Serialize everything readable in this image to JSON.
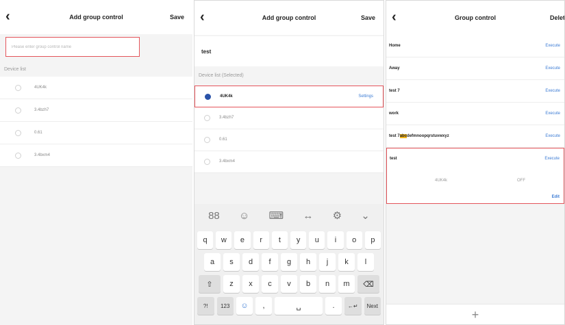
{
  "panel1": {
    "title": "Add group control",
    "save": "Save",
    "name_placeholder": "Please enter group control name",
    "list_label": "Device list",
    "devices": [
      "4UK4k",
      "3.4bzh7",
      "0.61",
      "3.4bxm4"
    ]
  },
  "panel2": {
    "title": "Add group control",
    "save": "Save",
    "name_value": "test",
    "list_label": "Device list (Selected)",
    "devices": [
      "4UK4k",
      "3.4bzh7",
      "0.61",
      "3.4bxm4"
    ],
    "selected_setting": "Settings",
    "keyboard": {
      "tools": [
        "88",
        "☺",
        "⌨",
        "↔",
        "⚙",
        "⌄"
      ],
      "row1": [
        "q",
        "w",
        "e",
        "r",
        "t",
        "y",
        "u",
        "i",
        "o",
        "p"
      ],
      "row2": [
        "a",
        "s",
        "d",
        "f",
        "g",
        "h",
        "j",
        "k",
        "l"
      ],
      "row3_shift": "⇧",
      "row3": [
        "z",
        "x",
        "c",
        "v",
        "b",
        "n",
        "m"
      ],
      "row3_del": "⌫",
      "row4": [
        "?!",
        "123",
        "☺",
        ",",
        "␣",
        ".",
        "←↵",
        "Next"
      ]
    }
  },
  "panel3": {
    "title": "Group control",
    "right_action": "Delete",
    "groups": [
      {
        "name": "Home",
        "exec": "Execute"
      },
      {
        "name": "Away",
        "exec": "Execute"
      },
      {
        "name": "test 7",
        "exec": "Execute"
      },
      {
        "name": "work",
        "exec": "Execute"
      },
      {
        "name_prefix": "test 7",
        "name_hl": "abc",
        "name_rest": "defmnoopqrstuvwxyz",
        "exec": "Execute"
      }
    ],
    "expanded": {
      "name": "test",
      "exec": "Execute",
      "device": "4UK4k",
      "state": "OFF",
      "edit": "Edit"
    },
    "add_label": "+"
  }
}
